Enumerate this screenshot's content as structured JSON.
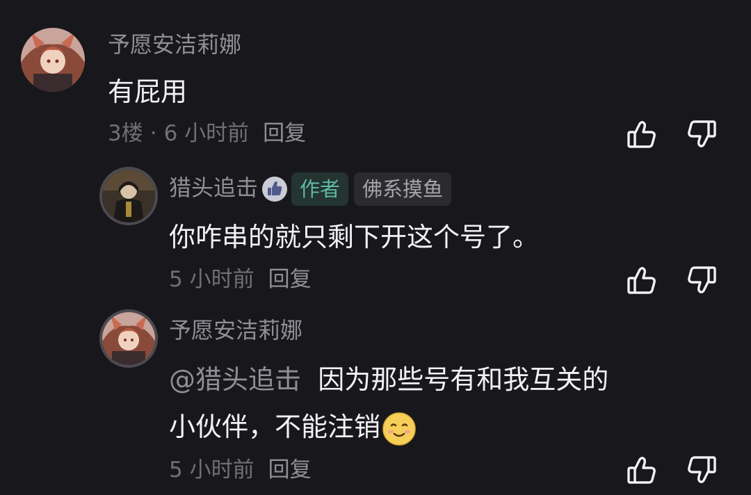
{
  "comments": [
    {
      "username": "予愿安洁莉娜",
      "content": "有屁用",
      "floor": "3楼",
      "separator": "·",
      "time": "6 小时前",
      "reply_label": "回复"
    },
    {
      "username": "猎头追击",
      "author_badge": "作者",
      "tag_badge": "佛系摸鱼",
      "content": "你咋串的就只剩下开这个号了。",
      "time": "5 小时前",
      "reply_label": "回复"
    },
    {
      "username": "予愿安洁莉娜",
      "mention": "@猎头追击",
      "content_line1": "因为那些号有和我互关的",
      "content_line2": "小伙伴，不能注销",
      "emoji": "smiling-face-emoji",
      "time": "5 小时前",
      "reply_label": "回复"
    }
  ],
  "icons": {
    "like": "thumbs-up-icon",
    "dislike": "thumbs-down-icon",
    "verified": "verified-thumb-icon"
  },
  "colors": {
    "background": "#18181c",
    "author_badge_bg": "#243430",
    "author_badge_text": "#5fb8a6"
  }
}
